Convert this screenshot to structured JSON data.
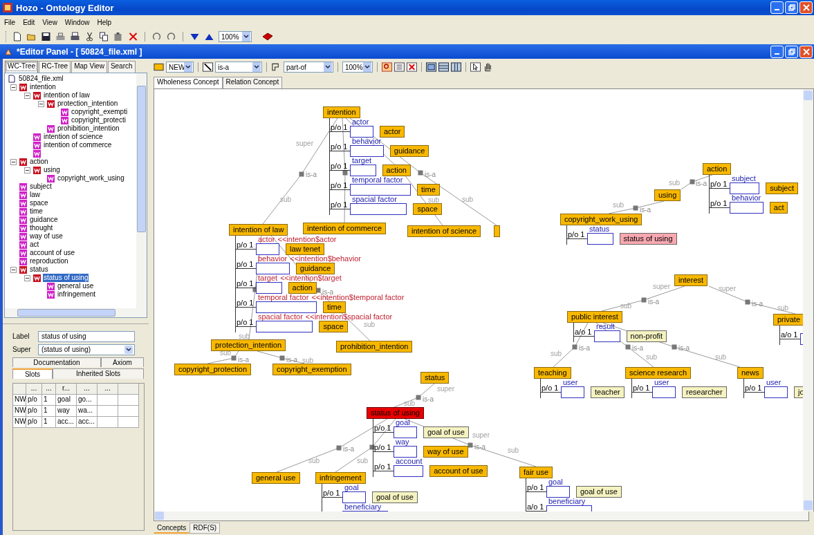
{
  "window": {
    "title": "Hozo - Ontology Editor"
  },
  "menu": [
    "File",
    "Edit",
    "View",
    "Window",
    "Help"
  ],
  "toolbar": {
    "zoom": "100%"
  },
  "panel": {
    "title": "*Editor Panel - [ 50824_file.xml ]"
  },
  "left_tabs": [
    {
      "label": "WC-Tree",
      "selected": true
    },
    {
      "label": "RC-Tree",
      "selected": false
    },
    {
      "label": "Map View",
      "selected": false
    },
    {
      "label": "Search",
      "selected": false
    }
  ],
  "tree": {
    "root": "50824_file.xml",
    "items": [
      {
        "label": "intention",
        "selected": false,
        "expanded": true,
        "children": [
          {
            "label": "intention of law",
            "selected": false,
            "expanded": true,
            "children": [
              {
                "label": "protection_intention",
                "selected": false,
                "expanded": true,
                "children": [
                  {
                    "label": "copyright_exempti",
                    "selected": false
                  },
                  {
                    "label": "copyright_protecti",
                    "selected": false
                  }
                ]
              },
              {
                "label": "prohibition_intention",
                "selected": false
              }
            ]
          },
          {
            "label": "intention of science",
            "selected": false
          },
          {
            "label": "intention of commerce",
            "selected": false
          },
          {
            "selected": false
          }
        ]
      },
      {
        "label": "action",
        "selected": false,
        "expanded": true,
        "children": [
          {
            "label": "using",
            "selected": false,
            "expanded": true,
            "children": [
              {
                "label": "copyright_work_using",
                "selected": false
              }
            ]
          }
        ]
      },
      {
        "label": "subject",
        "selected": false
      },
      {
        "label": "law",
        "selected": false
      },
      {
        "label": "space",
        "selected": false
      },
      {
        "label": "time",
        "selected": false
      },
      {
        "label": "guidance",
        "selected": false
      },
      {
        "label": "thought",
        "selected": false
      },
      {
        "label": "way of use",
        "selected": false
      },
      {
        "label": "act",
        "selected": false
      },
      {
        "label": "account of use",
        "selected": false
      },
      {
        "label": "reproduction",
        "selected": false
      },
      {
        "label": "status",
        "selected": false,
        "expanded": true,
        "children": [
          {
            "label": "status of using",
            "selected": true,
            "expanded": true,
            "children": [
              {
                "label": "general use",
                "selected": false
              },
              {
                "label": "infringement",
                "selected": false
              }
            ]
          }
        ]
      }
    ]
  },
  "label_field": {
    "label": "Label",
    "value": "status of using"
  },
  "super_field": {
    "label": "Super",
    "value": "(status of using)"
  },
  "detail_tabs": [
    [
      {
        "label": "Documentation",
        "selected": false
      },
      {
        "label": "Axiom",
        "selected": false
      }
    ],
    [
      {
        "label": "Slots",
        "selected": true
      },
      {
        "label": "Inherited Slots",
        "selected": false
      }
    ]
  ],
  "slots_table": {
    "columns": [
      "",
      "...",
      "...",
      "r...",
      "...",
      "..."
    ],
    "rows": [
      [
        "NW",
        "p/o",
        "1",
        "goal",
        "go..."
      ],
      [
        "NW",
        "p/o",
        "1",
        "way",
        "wa..."
      ],
      [
        "NW",
        "p/o",
        "1",
        "acc...",
        "acc..."
      ]
    ]
  },
  "editor_toolbar": {
    "node_type": "NEW",
    "link_type": "is-a",
    "part_type": "part-of",
    "zoom": "100%"
  },
  "canvas_tabs": [
    {
      "label": "Wholeness Concept",
      "selected": true
    },
    {
      "label": "Relation Concept",
      "selected": false
    }
  ],
  "diagram": {
    "nodes": [
      {
        "label": "intention",
        "selected": false,
        "slots": [
          {
            "prefix": "p/o 1",
            "role": "actor",
            "class": "actor",
            "kind": "concept"
          },
          {
            "prefix": "p/o 1",
            "role": "behavior",
            "class": "guidance",
            "kind": "concept"
          },
          {
            "prefix": "p/o 1",
            "role": "target",
            "class": "action",
            "kind": "concept"
          },
          {
            "prefix": "p/o 1",
            "role": "temporal factor",
            "class": "time",
            "kind": "concept"
          },
          {
            "prefix": "p/o 1",
            "role": "spacial factor",
            "class": "space",
            "kind": "concept"
          }
        ]
      },
      {
        "label": "action",
        "selected": false,
        "slots": [
          {
            "prefix": "p/o 1",
            "role": "subject",
            "class": "subject",
            "kind": "concept"
          },
          {
            "prefix": "p/o 1",
            "role": "behavior",
            "class": "act",
            "kind": "concept"
          }
        ]
      },
      {
        "label": "using",
        "selected": false
      },
      {
        "label": "copyright_work_using",
        "selected": false,
        "slots": [
          {
            "prefix": "p/o 1",
            "role": "status",
            "class": "status of using",
            "kind": "highlight"
          }
        ]
      },
      {
        "label": "intention of law",
        "selected": false,
        "slots": [
          {
            "prefix": "p/o 1",
            "role": "actor",
            "source": "<<intention$actor",
            "class": "law tenet",
            "kind": "concept"
          },
          {
            "prefix": "p/o 1",
            "role": "behavior",
            "source": "<<intention$behavior",
            "class": "guidance",
            "kind": "concept"
          },
          {
            "prefix": "p/o 1",
            "role": "target",
            "source": "<<intention$target",
            "class": "action",
            "kind": "concept"
          },
          {
            "prefix": "p/o 1",
            "role": "temporal factor",
            "source": "<<intention$temporal factor",
            "class": "time",
            "kind": "concept"
          },
          {
            "prefix": "p/o 1",
            "role": "spacial factor",
            "source": "<<intention$spacial factor",
            "class": "space",
            "kind": "concept"
          }
        ]
      },
      {
        "label": "intention of commerce",
        "selected": false
      },
      {
        "label": "intention of science",
        "selected": false
      },
      {
        "selected": false
      },
      {
        "label": "interest",
        "selected": false
      },
      {
        "label": "public interest",
        "selected": false,
        "slots": [
          {
            "prefix": "a/o 1",
            "role": "result",
            "class": "non-profit",
            "kind": "value"
          }
        ]
      },
      {
        "label": "private",
        "selected": false,
        "slots": [
          {
            "prefix": "a/o 1"
          }
        ]
      },
      {
        "label": "protection_intention",
        "selected": false
      },
      {
        "label": "prohibition_intention",
        "selected": false
      },
      {
        "label": "copyright_protection",
        "selected": false
      },
      {
        "label": "copyright_exemption",
        "selected": false
      },
      {
        "label": "status",
        "selected": false
      },
      {
        "label": "teaching",
        "selected": false,
        "slots": [
          {
            "prefix": "p/o 1",
            "role": "user",
            "class": "teacher",
            "kind": "value"
          }
        ]
      },
      {
        "label": "science research",
        "selected": false,
        "slots": [
          {
            "prefix": "p/o 1",
            "role": "user",
            "class": "researcher",
            "kind": "value"
          }
        ]
      },
      {
        "label": "news",
        "selected": false,
        "slots": [
          {
            "prefix": "p/o 1",
            "role": "user",
            "class": "jo",
            "kind": "value"
          }
        ]
      },
      {
        "label": "status of using",
        "selected": true,
        "slots": [
          {
            "prefix": "p/o 1",
            "role": "goal",
            "class": "goal of use",
            "kind": "value"
          },
          {
            "prefix": "p/o 1",
            "role": "way",
            "class": "way of use",
            "kind": "concept"
          },
          {
            "prefix": "p/o 1",
            "role": "account",
            "class": "account of use",
            "kind": "concept"
          }
        ]
      },
      {
        "label": "general use",
        "selected": false
      },
      {
        "label": "infringement",
        "selected": false,
        "slots": [
          {
            "prefix": "p/o 1",
            "role": "goal",
            "class": "goal of use",
            "kind": "value"
          },
          {
            "role": "beneficiary"
          }
        ]
      },
      {
        "label": "fair use",
        "selected": false,
        "slots": [
          {
            "prefix": "p/o 1",
            "role": "goal",
            "class": "goal of use",
            "kind": "value"
          },
          {
            "prefix": "a/o 1",
            "role": "beneficiary"
          }
        ]
      }
    ],
    "links": [
      {
        "kind": "is-a",
        "label": "is-a",
        "sub": "sub",
        "super": "super"
      },
      {
        "kind": "is-a"
      },
      {
        "kind": "is-a",
        "sub": "sub"
      },
      {
        "kind": "is-a",
        "label": "is-a",
        "sub": "sub"
      },
      {
        "kind": "is-a",
        "sub": "sub"
      },
      {
        "kind": "is-a",
        "label": "is-a",
        "sub": "sub"
      },
      {
        "kind": "is-a",
        "label": "is-a",
        "sub": "sub"
      },
      {
        "kind": "is-a",
        "label": "is-a",
        "sub": "sub"
      },
      {
        "kind": "is-a",
        "label": "is-a",
        "sub": "sub"
      },
      {
        "kind": "is-a",
        "label": "is-a",
        "sub": "sub"
      },
      {
        "kind": "is-a",
        "label": "is-a",
        "sub": "sub",
        "super": "super"
      },
      {
        "kind": "is-a",
        "label": "is-a",
        "sub": "sub",
        "super": "super"
      },
      {
        "kind": "is-a",
        "label": "is-a",
        "sub": "sub"
      },
      {
        "kind": "is-a",
        "label": "is-a",
        "sub": "sub"
      },
      {
        "kind": "is-a",
        "label": "is-a",
        "sub": "sub"
      },
      {
        "kind": "is-a",
        "label": "is-a",
        "sub": "sub",
        "super": "super"
      },
      {
        "kind": "is-a",
        "label": "is-a",
        "sub": "sub"
      },
      {
        "kind": "is-a",
        "sub": "sub"
      },
      {
        "kind": "is-a",
        "label": "is-a",
        "sub": "sub",
        "super": "super"
      }
    ]
  },
  "bottom_tabs": [
    {
      "label": "Concepts",
      "selected": true
    },
    {
      "label": "RDF(S)",
      "selected": false
    }
  ]
}
